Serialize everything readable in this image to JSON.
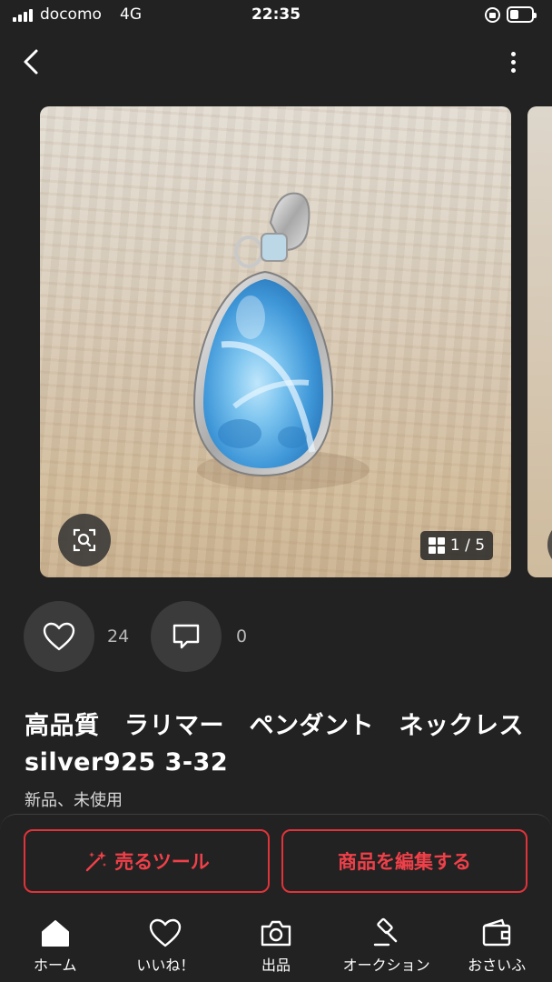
{
  "status_bar": {
    "carrier": "docomo",
    "network": "4G",
    "time": "22:35",
    "battery_level": 0.4
  },
  "gallery": {
    "counter": "1 / 5"
  },
  "social": {
    "like_count": "24",
    "comment_count": "0"
  },
  "item": {
    "title": "高品質　ラリマー　ペンダント　ネックレス　silver925 3-32",
    "condition": "新品、未使用"
  },
  "actions": {
    "sell_tool_label": "売るツール",
    "edit_item_label": "商品を編集する"
  },
  "tab_bar": {
    "items": [
      {
        "label": "ホーム",
        "icon": "home-icon"
      },
      {
        "label": "いいね！",
        "icon": "heart-icon"
      },
      {
        "label": "出品",
        "icon": "camera-icon"
      },
      {
        "label": "オークション",
        "icon": "gavel-icon"
      },
      {
        "label": "おさいふ",
        "icon": "wallet-icon"
      }
    ]
  },
  "colors": {
    "background": "#222222",
    "accent": "#e0333a",
    "button_surface": "#3b3b3b"
  }
}
